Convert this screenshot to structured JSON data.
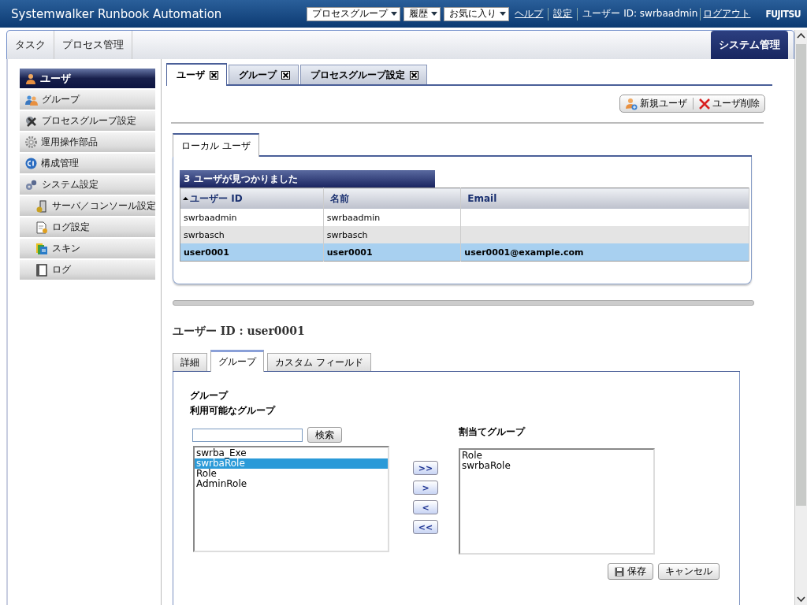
{
  "header": {
    "title": "Systemwalker Runbook Automation",
    "menus": [
      {
        "label": "プロセスグループ"
      },
      {
        "label": "履歴"
      },
      {
        "label": "お気に入り"
      }
    ],
    "links": [
      "ヘルプ",
      "設定"
    ],
    "user": "ユーザー ID: swrbaadmin",
    "logout": "ログアウト",
    "logo": "FUJITSU"
  },
  "nav": {
    "tabs": [
      {
        "label": "タスク",
        "selected": false
      },
      {
        "label": "プロセス管理",
        "selected": false
      }
    ],
    "active_tab": {
      "label": "システム管理",
      "selected": true
    }
  },
  "sidebar": {
    "items": [
      {
        "label": "ユーザ",
        "selected": true
      },
      {
        "label": "グループ",
        "selected": false
      },
      {
        "label": "プロセスグループ設定",
        "selected": false
      },
      {
        "label": "運用操作部品",
        "selected": false
      },
      {
        "label": "構成管理",
        "selected": false
      },
      {
        "label": "システム設定",
        "selected": false,
        "children": [
          {
            "label": "サーバ／コンソール設定",
            "selected": false
          },
          {
            "label": "ログ設定",
            "selected": false
          },
          {
            "label": "スキン",
            "selected": false
          },
          {
            "label": "ログ",
            "selected": false
          }
        ]
      }
    ]
  },
  "tabs": [
    {
      "label": "ユーザ",
      "selected": true
    },
    {
      "label": "グループ",
      "selected": false
    },
    {
      "label": "プロセスグループ設定",
      "selected": false
    }
  ],
  "toolbar": [
    "新規ユーザ",
    "ユーザ削除"
  ],
  "subtabs": [
    {
      "label": "ローカル ユーザ",
      "selected": true
    }
  ],
  "table": {
    "caption": "3 ユーザが見つかりました",
    "columns": [
      {
        "label": "ユーザー ID",
        "sorted": true
      },
      {
        "label": "名前",
        "sorted": false
      },
      {
        "label": "Email",
        "sorted": false
      }
    ],
    "rows": [
      {
        "cells": [
          "swrbaadmin",
          "swrbaadmin",
          ""
        ],
        "selected": false
      },
      {
        "cells": [
          "swrbasch",
          "swrbasch",
          ""
        ],
        "selected": false
      },
      {
        "cells": [
          "user0001",
          "user0001",
          "user0001@example.com"
        ],
        "selected": true
      }
    ]
  },
  "detail": {
    "title": "ユーザー ID : user0001",
    "tabs": [
      {
        "label": "詳細",
        "selected": false
      },
      {
        "label": "グループ",
        "selected": true
      },
      {
        "label": "カスタム フィールド",
        "selected": false
      }
    ],
    "section": "グループ",
    "available_label": "利用可能なグループ",
    "search_button": "検索",
    "available": [
      {
        "label": "swrba_Exe",
        "selected": false
      },
      {
        "label": "swrbaRole",
        "selected": true
      },
      {
        "label": "Role",
        "selected": false
      },
      {
        "label": "AdminRole",
        "selected": false
      }
    ],
    "move_buttons": [
      ">>",
      ">",
      "<",
      "<<"
    ],
    "assigned_label": "割当てグループ",
    "assigned": [
      {
        "label": "Role",
        "selected": false
      },
      {
        "label": "swrbaRole",
        "selected": false
      }
    ],
    "save": "保存",
    "cancel": "キャンセル"
  }
}
